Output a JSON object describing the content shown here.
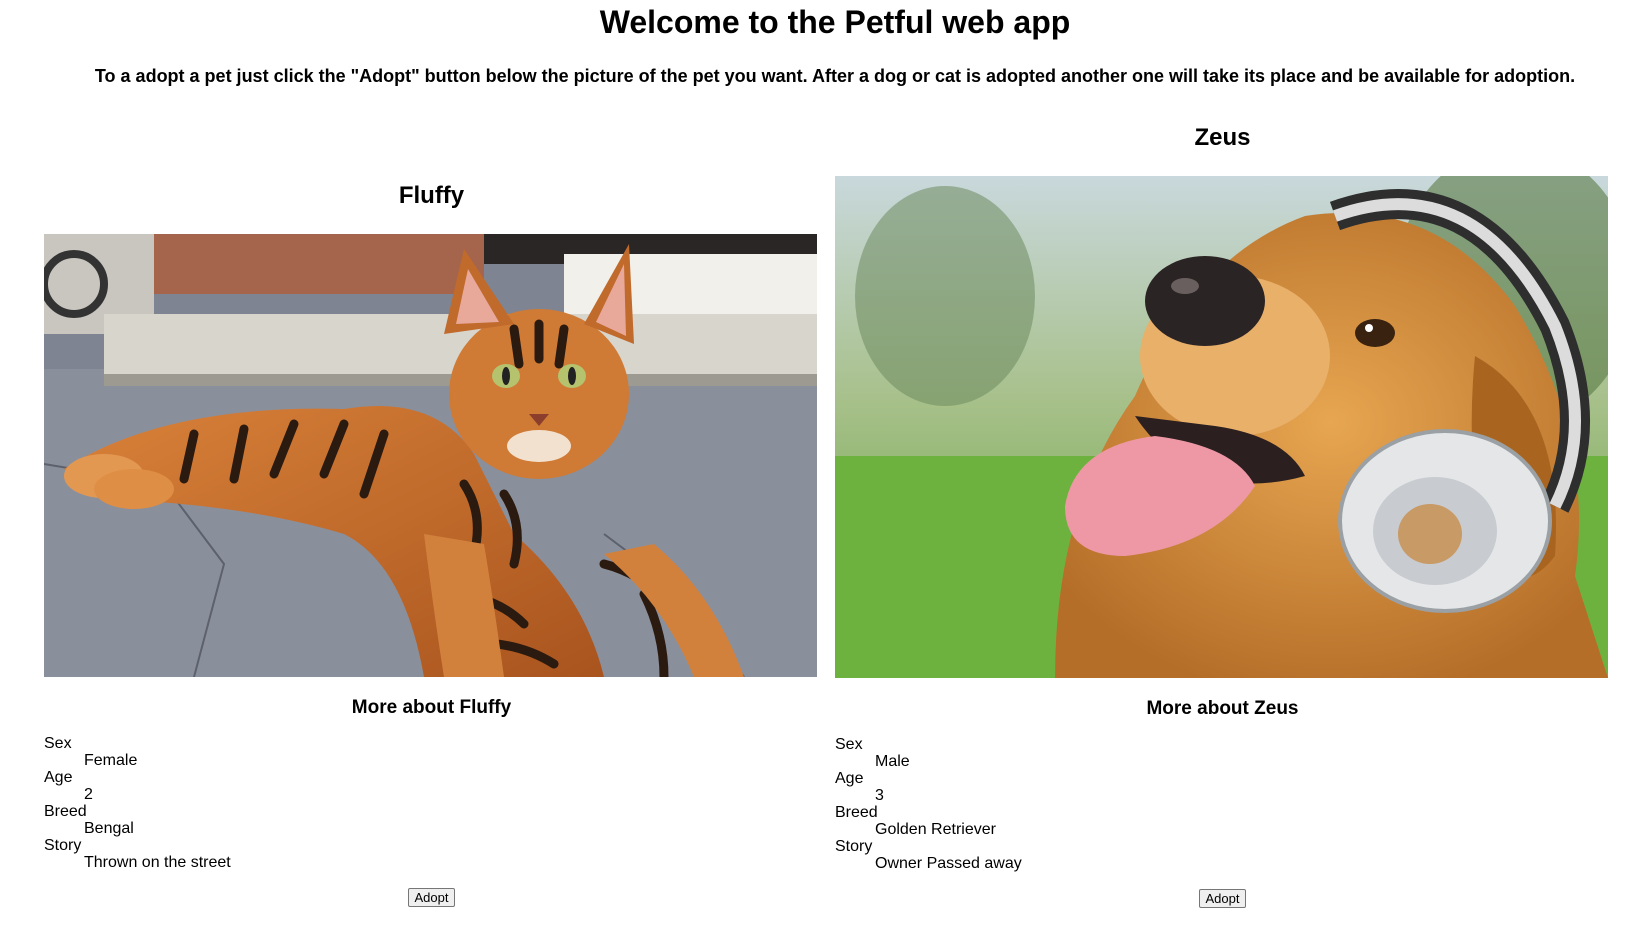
{
  "header": {
    "title": "Welcome to the Petful web app",
    "intro": "To a adopt a pet just click the \"Adopt\" button below the picture of the pet you want. After a dog or cat is adopted another one will take its place and be available for adoption."
  },
  "cat": {
    "name": "Fluffy",
    "image_label": "Bengal cat lying on pavement",
    "more_title": "More about Fluffy",
    "labels": {
      "sex": "Sex",
      "age": "Age",
      "breed": "Breed",
      "story": "Story"
    },
    "sex": "Female",
    "age": "2",
    "breed": "Bengal",
    "story": "Thrown on the street",
    "adopt_label": "Adopt"
  },
  "dog": {
    "name": "Zeus",
    "image_label": "Golden retriever wearing headphones",
    "more_title": "More about Zeus",
    "labels": {
      "sex": "Sex",
      "age": "Age",
      "breed": "Breed",
      "story": "Story"
    },
    "sex": "Male",
    "age": "3",
    "breed": "Golden Retriever",
    "story": "Owner Passed away",
    "adopt_label": "Adopt"
  }
}
